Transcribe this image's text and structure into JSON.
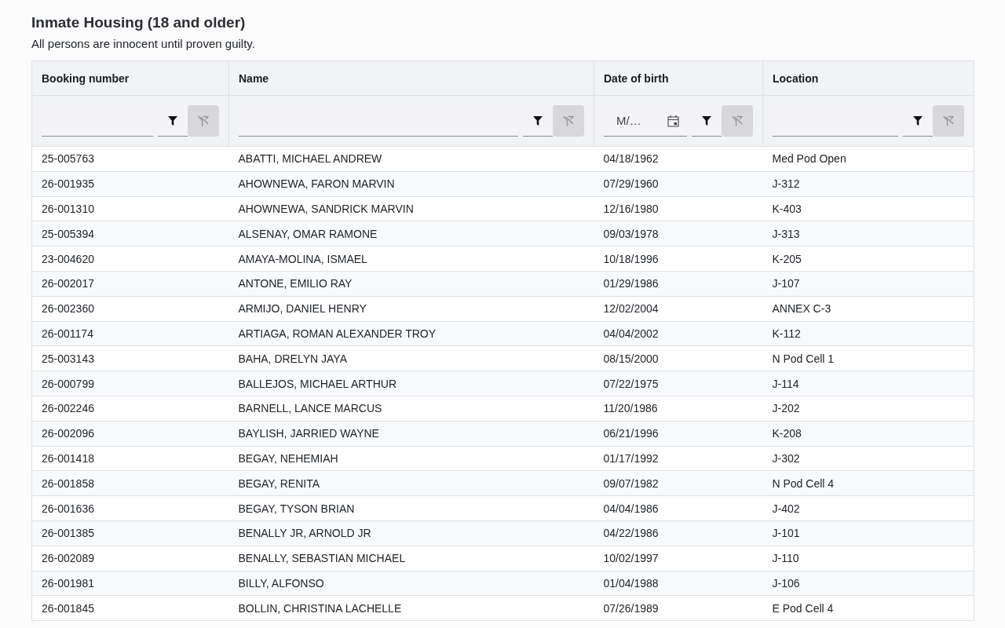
{
  "page": {
    "title": "Inmate Housing (18 and older)",
    "subtitle": "All persons are innocent until proven guilty."
  },
  "table": {
    "columns": [
      {
        "label": "Booking number",
        "filter": {
          "kind": "text",
          "clear_disabled": true
        }
      },
      {
        "label": "Name",
        "filter": {
          "kind": "text",
          "clear_disabled": true
        }
      },
      {
        "label": "Date of birth",
        "filter": {
          "kind": "date",
          "placeholder": "M/…",
          "clear_disabled": true
        }
      },
      {
        "label": "Location",
        "filter": {
          "kind": "text",
          "clear_disabled": true
        }
      }
    ],
    "rows": [
      [
        "25-005763",
        "ABATTI, MICHAEL ANDREW",
        "04/18/1962",
        "Med Pod Open"
      ],
      [
        "26-001935",
        "AHOWNEWA, FARON MARVIN",
        "07/29/1960",
        "J-312"
      ],
      [
        "26-001310",
        "AHOWNEWA, SANDRICK MARVIN",
        "12/16/1980",
        "K-403"
      ],
      [
        "25-005394",
        "ALSENAY, OMAR RAMONE",
        "09/03/1978",
        "J-313"
      ],
      [
        "23-004620",
        "AMAYA-MOLINA, ISMAEL",
        "10/18/1996",
        "K-205"
      ],
      [
        "26-002017",
        "ANTONE, EMILIO RAY",
        "01/29/1986",
        "J-107"
      ],
      [
        "26-002360",
        "ARMIJO, DANIEL HENRY",
        "12/02/2004",
        "ANNEX C-3"
      ],
      [
        "26-001174",
        "ARTIAGA, ROMAN ALEXANDER TROY",
        "04/04/2002",
        "K-112"
      ],
      [
        "25-003143",
        "BAHA, DRELYN JAYA",
        "08/15/2000",
        "N Pod Cell 1"
      ],
      [
        "26-000799",
        "BALLEJOS, MICHAEL ARTHUR",
        "07/22/1975",
        "J-114"
      ],
      [
        "26-002246",
        "BARNELL, LANCE MARCUS",
        "11/20/1986",
        "J-202"
      ],
      [
        "26-002096",
        "BAYLISH, JARRIED WAYNE",
        "06/21/1996",
        "K-208"
      ],
      [
        "26-001418",
        "BEGAY, NEHEMIAH",
        "01/17/1992",
        "J-302"
      ],
      [
        "26-001858",
        "BEGAY, RENITA",
        "09/07/1982",
        "N Pod Cell 4"
      ],
      [
        "26-001636",
        "BEGAY, TYSON BRIAN",
        "04/04/1986",
        "J-402"
      ],
      [
        "26-001385",
        "BENALLY JR, ARNOLD JR",
        "04/22/1986",
        "J-101"
      ],
      [
        "26-002089",
        "BENALLY, SEBASTIAN MICHAEL",
        "10/02/1997",
        "J-110"
      ],
      [
        "26-001981",
        "BILLY, ALFONSO",
        "01/04/1988",
        "J-106"
      ],
      [
        "26-001845",
        "BOLLIN, CHRISTINA LACHELLE",
        "07/26/1989",
        "E Pod Cell 4"
      ]
    ]
  }
}
